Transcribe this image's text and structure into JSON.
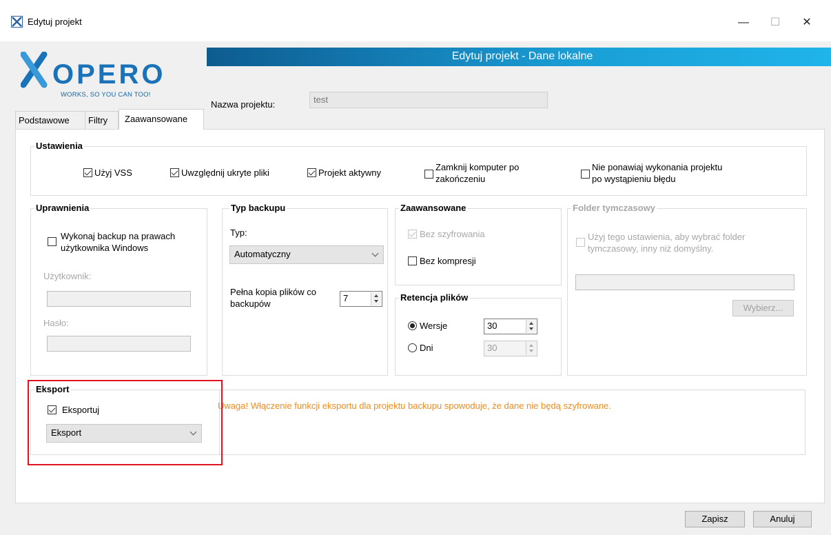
{
  "window": {
    "title": "Edytuj projekt",
    "minimize": "—",
    "maximize": "☐",
    "close": "✕"
  },
  "banner": {
    "title": "Edytuj projekt - Dane lokalne"
  },
  "logo": {
    "brand": "XOPERO",
    "tagline": "WORKS, SO YOU CAN TOO!",
    "colors": {
      "x": "#1a73b8",
      "text": "#1a73b8"
    }
  },
  "project": {
    "name_label": "Nazwa projektu:",
    "name_value": "test"
  },
  "tabs": [
    {
      "label": "Podstawowe"
    },
    {
      "label": "Filtry"
    },
    {
      "label": "Zaawansowane",
      "active": true
    }
  ],
  "ustawienia": {
    "title": "Ustawienia",
    "use_vss": {
      "label": "Użyj VSS",
      "checked": true
    },
    "hidden_files": {
      "label": "Uwzględnij ukryte pliki",
      "checked": true
    },
    "project_active": {
      "label": "Projekt aktywny",
      "checked": true
    },
    "shutdown": {
      "label_line1": "Zamknij komputer po",
      "label_line2": "zakończeniu",
      "checked": false
    },
    "no_retry": {
      "label_line1": "Nie ponawiaj wykonania projektu",
      "label_line2": "po wystąpieniu błędu",
      "checked": false
    }
  },
  "uprawnienia": {
    "title": "Uprawnienia",
    "run_as": {
      "label_line1": "Wykonaj backup na prawach",
      "label_line2": "użytkownika Windows",
      "checked": false
    },
    "user_label": "Użytkownik:",
    "user_value": "",
    "password_label": "Hasło:",
    "password_value": ""
  },
  "typ_backupu": {
    "title": "Typ backupu",
    "type_label": "Typ:",
    "type_value": "Automatyczny",
    "full_copy_label_line1": "Pełna kopia plików co",
    "full_copy_label_line2": "backupów",
    "full_copy_value": "7"
  },
  "zaawansowane": {
    "title": "Zaawansowane",
    "no_encryption": {
      "label": "Bez szyfrowania",
      "checked": true,
      "disabled": true
    },
    "no_compression": {
      "label": "Bez kompresji",
      "checked": false
    }
  },
  "retencja": {
    "title": "Retencja plików",
    "versions": {
      "label": "Wersje",
      "selected": true,
      "value": "30"
    },
    "days": {
      "label": "Dni",
      "selected": false,
      "value": "30"
    }
  },
  "folder_tymczasowy": {
    "title": "Folder tymczasowy",
    "use": {
      "label_line1": "Użyj tego ustawienia, aby wybrać folder",
      "label_line2": "tymczasowy, inny niż domyślny.",
      "checked": false
    },
    "path_value": "",
    "browse_label": "Wybierz..."
  },
  "eksport": {
    "title": "Eksport",
    "export": {
      "label": "Eksportuj",
      "checked": true
    },
    "target_value": "Eksport",
    "warning": "Uwaga! Włączenie funkcji eksportu dla projektu backupu spowoduje, że dane nie będą szyfrowane.",
    "warning_color": "#f28a1d",
    "highlight_color": "#e0141e"
  },
  "footer": {
    "save_label": "Zapisz",
    "cancel_label": "Anuluj"
  }
}
